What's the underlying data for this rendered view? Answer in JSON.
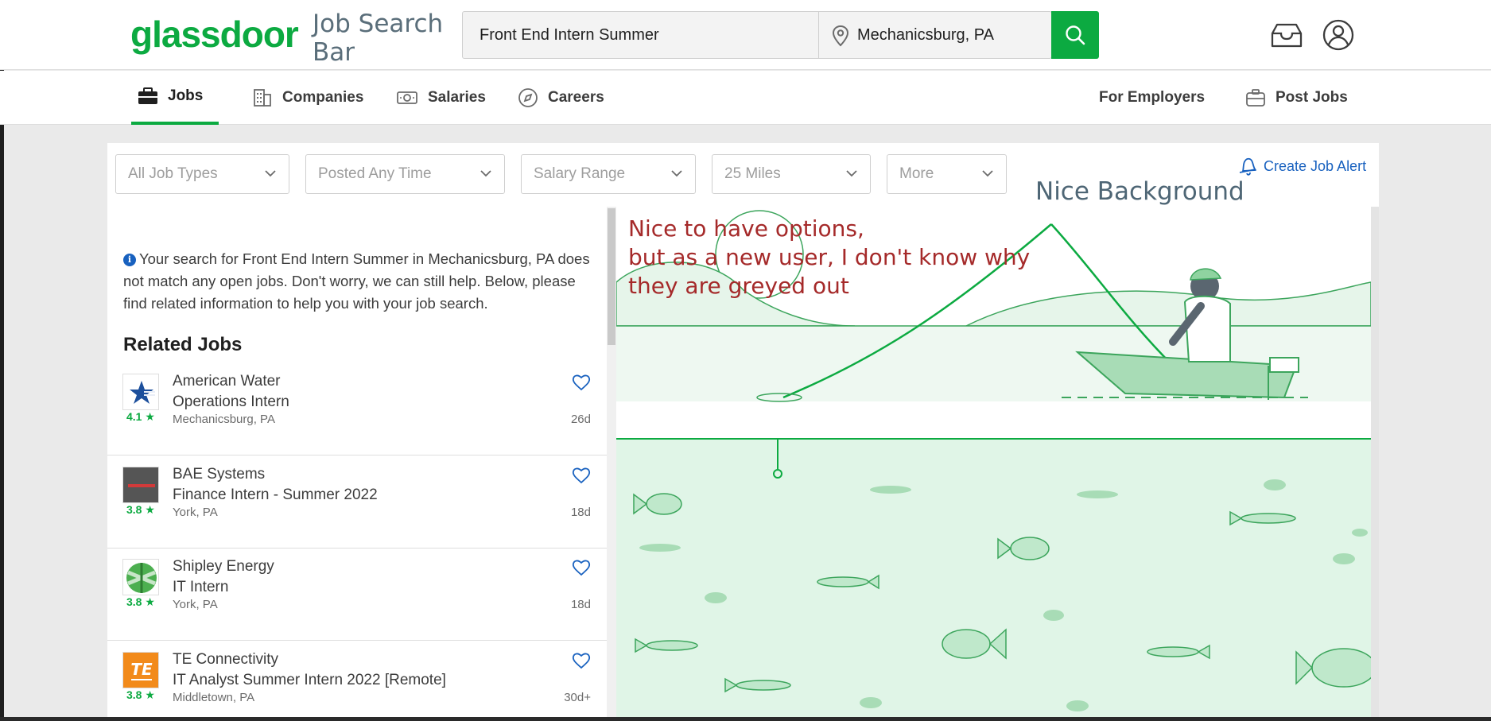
{
  "header": {
    "logo": "glassdoor",
    "annotation": "Job Search Bar",
    "search": {
      "keyword_value": "Front End Intern Summer",
      "location_value": "Mechanicsburg, PA"
    }
  },
  "nav": {
    "items": [
      {
        "label": "Jobs",
        "icon": "briefcase-icon"
      },
      {
        "label": "Companies",
        "icon": "building-icon"
      },
      {
        "label": "Salaries",
        "icon": "money-icon"
      },
      {
        "label": "Careers",
        "icon": "compass-icon"
      }
    ],
    "right_items": [
      {
        "label": "For Employers"
      },
      {
        "label": "Post Jobs",
        "icon": "briefcase-outline-icon"
      }
    ]
  },
  "filters": {
    "items": [
      {
        "label": "All Job Types"
      },
      {
        "label": "Posted Any Time"
      },
      {
        "label": "Salary Range"
      },
      {
        "label": "25 Miles"
      },
      {
        "label": "More"
      }
    ],
    "create_alert": "Create Job Alert",
    "annotation": "Nice Background"
  },
  "results": {
    "notice": "Your search for Front End Intern Summer in Mechanicsburg, PA does not match any open jobs. Don't worry, we can still help. Below, please find related information to help you with your job search.",
    "related_title": "Related Jobs",
    "jobs": [
      {
        "company": "American Water",
        "title": "Operations Intern",
        "location": "Mechanicsburg, PA",
        "rating": "4.1 ★",
        "age": "26d"
      },
      {
        "company": "BAE Systems",
        "title": "Finance Intern - Summer 2022",
        "location": "York, PA",
        "rating": "3.8 ★",
        "age": "18d"
      },
      {
        "company": "Shipley Energy",
        "title": "IT Intern",
        "location": "York, PA",
        "rating": "3.8 ★",
        "age": "18d"
      },
      {
        "company": "TE Connectivity",
        "title": "IT Analyst Summer Intern 2022 [Remote]",
        "location": "Middletown, PA",
        "rating": "3.8 ★",
        "age": "30d+"
      }
    ]
  },
  "annotation_options": {
    "line1": "Nice to have options,",
    "line2": "but as a new user, I don't know why",
    "line3": "they are greyed out"
  },
  "colors": {
    "brand_green": "#0caa41",
    "link_blue": "#1861bf",
    "annotation_red": "#a52a2a"
  }
}
